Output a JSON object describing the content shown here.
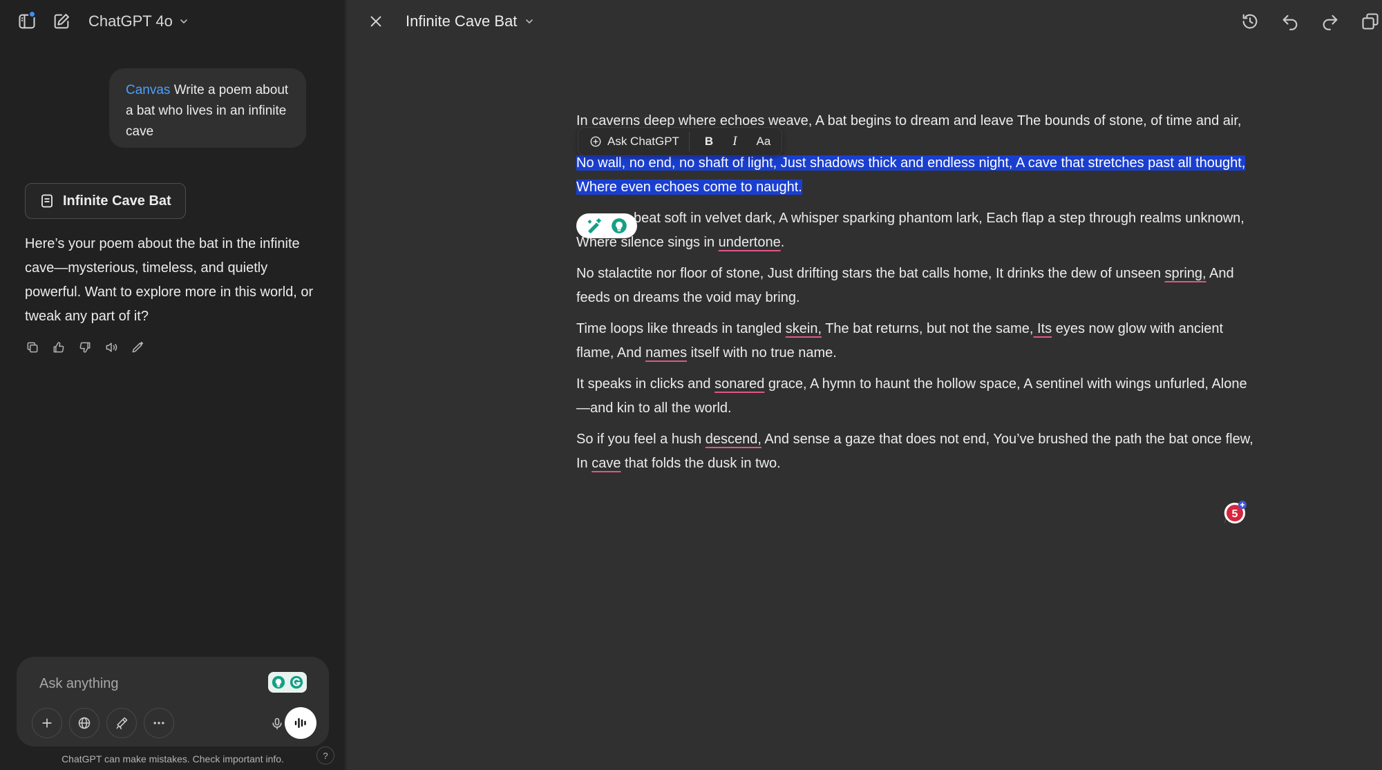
{
  "header": {
    "model_name": "ChatGPT 4o"
  },
  "chat": {
    "user_message": {
      "tag": "Canvas",
      "text": "Write a poem about a bat who lives in an infinite cave"
    },
    "doc_chip_label": "Infinite Cave Bat",
    "assistant_message": "Here’s your poem about the bat in the infinite cave—mysterious, timeless, and quietly powerful. Want to explore more in this world, or tweak any part of it?"
  },
  "composer": {
    "placeholder": "Ask anything",
    "disclaimer": "ChatGPT can make mistakes. Check important info.",
    "help_label": "?"
  },
  "canvas": {
    "title": "Infinite Cave Bat",
    "toolbar": {
      "ask_label": "Ask ChatGPT",
      "bold_label": "B",
      "italic_label": "I",
      "text_size_label": "Aa"
    },
    "stanzas": {
      "s1": "In caverns deep where echoes weave, A bat begins to dream and leave The bounds of stone, of time and air,",
      "s2": "No wall, no end, no shaft of light, Just shadows thick and endless night, A cave that stretches past all thought, Where even echoes come to naught.",
      "s3_pre": "beat soft in velvet dark, A whisper sparking phantom lark, Each flap a step through realms unknown, Where silence sings in ",
      "s3_err": "undertone",
      "s3_post": ".",
      "s4_pre": "No stalactite nor floor of stone, Just drifting stars the bat calls home, It drinks the dew of unseen ",
      "s4_err": "spring,",
      "s4_post": " And feeds on dreams the void may bring.",
      "s5_a": "Time loops like threads in tangled ",
      "s5_err1": "skein,",
      "s5_b": " The bat returns, but not the same,",
      "s5_err2": " Its",
      "s5_c": " eyes now glow with ancient flame, And ",
      "s5_err3": "names",
      "s5_d": " itself with no true name.",
      "s6_a": "It speaks in clicks and ",
      "s6_err": "sonared",
      "s6_b": " grace, A hymn to haunt the hollow space, A sentinel with wings unfurled, Alone—and kin to all the world.",
      "s7_a": "So if you feel a hush ",
      "s7_err1": "descend,",
      "s7_b": " And sense a gaze that does not end, You’ve brushed the path the bat once flew, In ",
      "s7_err2": "cave",
      "s7_c": " that folds the dusk in two."
    },
    "issue_count": "5"
  },
  "colors": {
    "selection": "#1a3fcf",
    "link_tag": "#4aa0ff",
    "spell_underline": "#e0578a",
    "badge_red": "#d6263d"
  }
}
